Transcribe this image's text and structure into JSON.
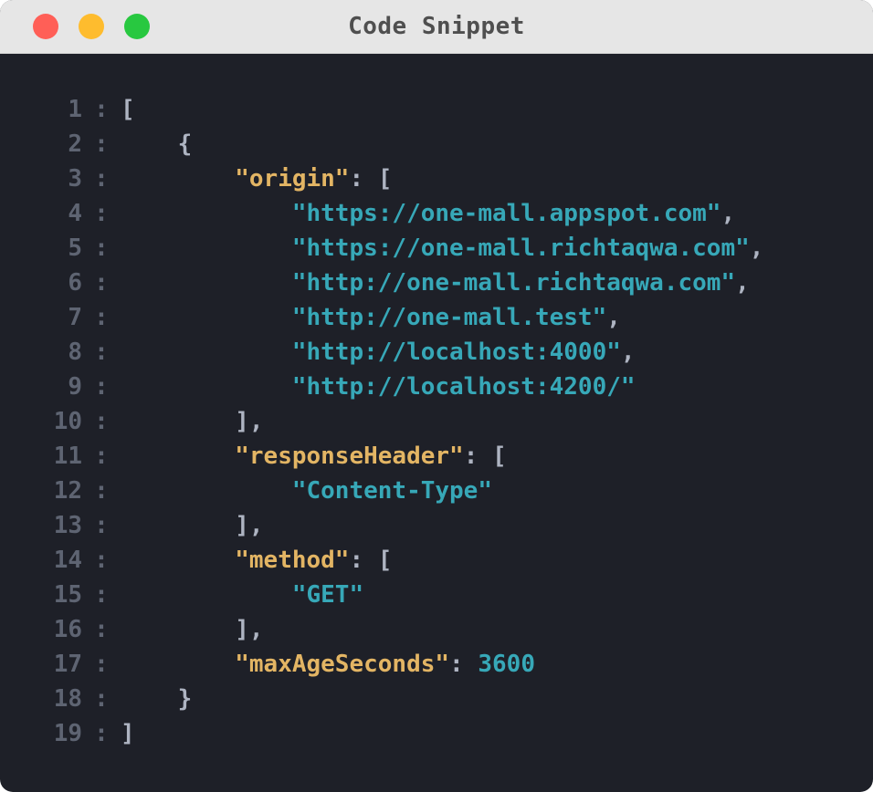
{
  "window": {
    "title": "Code Snippet",
    "controls": [
      "close",
      "minimize",
      "maximize"
    ]
  },
  "code": {
    "separator": ":",
    "lines": [
      {
        "number": "1",
        "indent": "",
        "tokens": [
          {
            "t": "[",
            "c": "p"
          }
        ]
      },
      {
        "number": "2",
        "indent": "    ",
        "tokens": [
          {
            "t": "{",
            "c": "p"
          }
        ]
      },
      {
        "number": "3",
        "indent": "        ",
        "tokens": [
          {
            "t": "\"origin\"",
            "c": "k"
          },
          {
            "t": ": [",
            "c": "p"
          }
        ]
      },
      {
        "number": "4",
        "indent": "            ",
        "tokens": [
          {
            "t": "\"https://one-mall.appspot.com\"",
            "c": "s"
          },
          {
            "t": ",",
            "c": "p"
          }
        ]
      },
      {
        "number": "5",
        "indent": "            ",
        "tokens": [
          {
            "t": "\"https://one-mall.richtaqwa.com\"",
            "c": "s"
          },
          {
            "t": ",",
            "c": "p"
          }
        ]
      },
      {
        "number": "6",
        "indent": "            ",
        "tokens": [
          {
            "t": "\"http://one-mall.richtaqwa.com\"",
            "c": "s"
          },
          {
            "t": ",",
            "c": "p"
          }
        ]
      },
      {
        "number": "7",
        "indent": "            ",
        "tokens": [
          {
            "t": "\"http://one-mall.test\"",
            "c": "s"
          },
          {
            "t": ",",
            "c": "p"
          }
        ]
      },
      {
        "number": "8",
        "indent": "            ",
        "tokens": [
          {
            "t": "\"http://localhost:4000\"",
            "c": "s"
          },
          {
            "t": ",",
            "c": "p"
          }
        ]
      },
      {
        "number": "9",
        "indent": "            ",
        "tokens": [
          {
            "t": "\"http://localhost:4200/\"",
            "c": "s"
          }
        ]
      },
      {
        "number": "10",
        "indent": "        ",
        "tokens": [
          {
            "t": "],",
            "c": "p"
          }
        ]
      },
      {
        "number": "11",
        "indent": "        ",
        "tokens": [
          {
            "t": "\"responseHeader\"",
            "c": "k"
          },
          {
            "t": ": [",
            "c": "p"
          }
        ]
      },
      {
        "number": "12",
        "indent": "            ",
        "tokens": [
          {
            "t": "\"Content-Type\"",
            "c": "s"
          }
        ]
      },
      {
        "number": "13",
        "indent": "        ",
        "tokens": [
          {
            "t": "],",
            "c": "p"
          }
        ]
      },
      {
        "number": "14",
        "indent": "        ",
        "tokens": [
          {
            "t": "\"method\"",
            "c": "k"
          },
          {
            "t": ": [",
            "c": "p"
          }
        ]
      },
      {
        "number": "15",
        "indent": "            ",
        "tokens": [
          {
            "t": "\"GET\"",
            "c": "s"
          }
        ]
      },
      {
        "number": "16",
        "indent": "        ",
        "tokens": [
          {
            "t": "],",
            "c": "p"
          }
        ]
      },
      {
        "number": "17",
        "indent": "        ",
        "tokens": [
          {
            "t": "\"maxAgeSeconds\"",
            "c": "k"
          },
          {
            "t": ": ",
            "c": "p"
          },
          {
            "t": "3600",
            "c": "n"
          }
        ]
      },
      {
        "number": "18",
        "indent": "    ",
        "tokens": [
          {
            "t": "}",
            "c": "p"
          }
        ]
      },
      {
        "number": "19",
        "indent": "",
        "tokens": [
          {
            "t": "]",
            "c": "p"
          }
        ]
      }
    ]
  },
  "colors": {
    "background": "#1e2028",
    "titlebar": "#e6e6e6",
    "line_number": "#5e6472",
    "punctuation": "#aeb4c2",
    "key": "#e3b564",
    "string": "#37a8b8",
    "close": "#ff5f57",
    "minimize": "#febc2e",
    "maximize": "#28c840"
  }
}
